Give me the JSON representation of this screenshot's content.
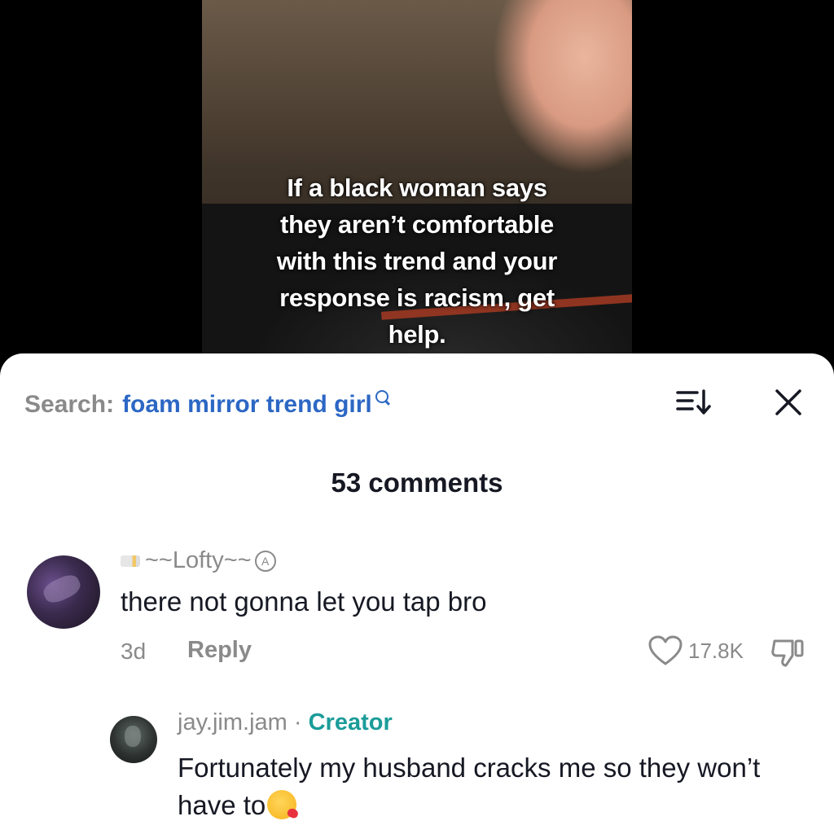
{
  "video": {
    "caption_lines": [
      "If a black woman says",
      "they aren’t comfortable",
      "with this trend and your",
      "response is racism, get",
      "help."
    ]
  },
  "header": {
    "search_label": "Search:",
    "search_term": "foam mirror trend girl",
    "icons": [
      "search-icon",
      "sort-icon",
      "close-icon"
    ]
  },
  "comments_count": "53 comments",
  "comments": [
    {
      "username": "Lofty",
      "username_decoration": "~~Lofty~~",
      "text": "there not gonna let you tap bro",
      "time": "3d",
      "reply_label": "Reply",
      "likes": "17.8K"
    },
    {
      "username": "jay.jim.jam",
      "separator": " · ",
      "role": "Creator",
      "text": "Fortunately my husband cracks me so they won’t have to",
      "emoji": "kissing-face-with-heart"
    }
  ],
  "colors": {
    "accent_blue": "#2c67c4",
    "creator_teal": "#1b9c9a",
    "muted_gray": "#8a8a8a",
    "text_dark": "#161823"
  }
}
